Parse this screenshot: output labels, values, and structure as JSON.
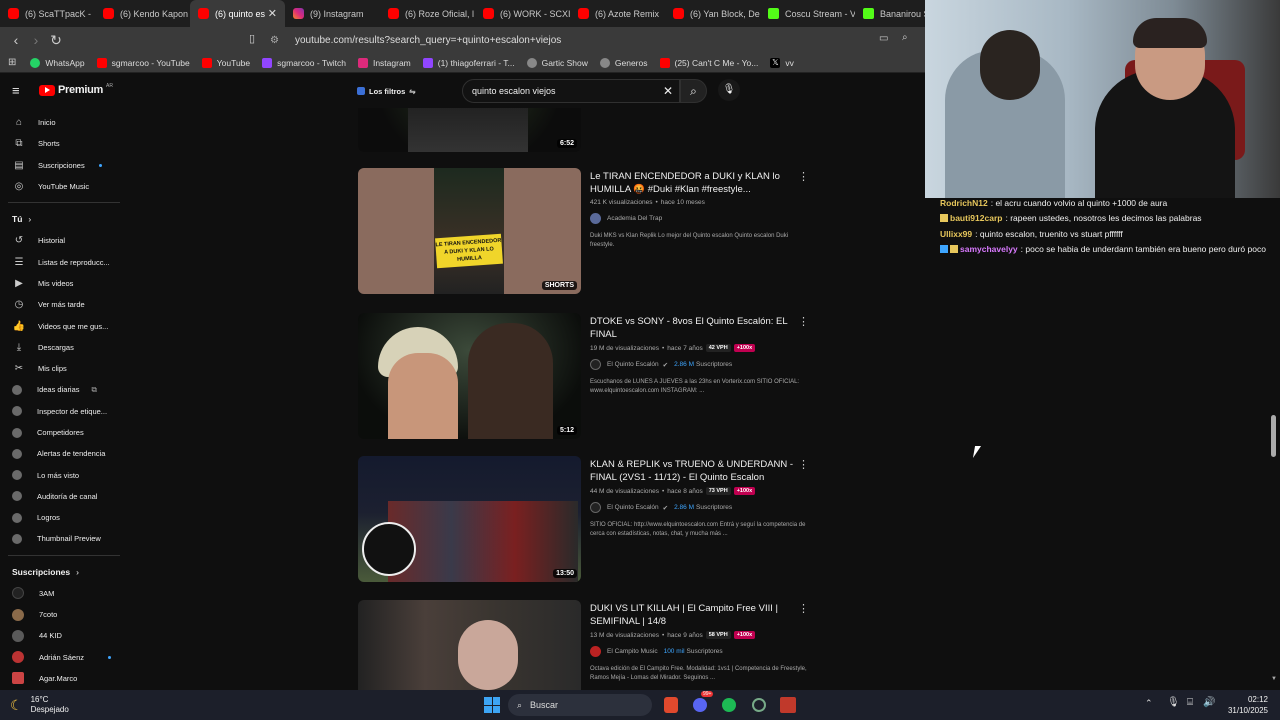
{
  "browser": {
    "tabs": [
      {
        "label": "(6) ScaTTpacK -",
        "icon": "youtube"
      },
      {
        "label": "(6) Kendo Kapon",
        "icon": "youtube"
      },
      {
        "label": "(6) quinto es",
        "icon": "youtube",
        "active": true
      },
      {
        "label": "(9) Instagram",
        "icon": "instagram"
      },
      {
        "label": "(6) Roze Oficial, l",
        "icon": "youtube"
      },
      {
        "label": "(6) WORK - SCXI",
        "icon": "youtube"
      },
      {
        "label": "(6) Azote Remix",
        "icon": "youtube"
      },
      {
        "label": "(6) Yan Block, De",
        "icon": "youtube"
      },
      {
        "label": "Coscu Stream - V",
        "icon": "kick"
      },
      {
        "label": "Bananirou St",
        "icon": "kick"
      }
    ],
    "close_glyph": "✕",
    "url": "youtube.com/results?search_query=+quinto+escalon+viejos",
    "bookmarks": [
      {
        "label": "WhatsApp",
        "color": "#25d366"
      },
      {
        "label": "sgmarcoo - YouTube",
        "color": "#ff0000"
      },
      {
        "label": "YouTube",
        "color": "#ff0000"
      },
      {
        "label": "sgmarcoo - Twitch",
        "color": "#9146ff"
      },
      {
        "label": "Instagram",
        "color": "#dd2a7b"
      },
      {
        "label": "(1) thiagoferrari - T...",
        "color": "#9146ff"
      },
      {
        "label": "Gartic Show",
        "color": "#888888"
      },
      {
        "label": "Generos",
        "color": "#888888"
      },
      {
        "label": "(25) Can't C Me - Yo...",
        "color": "#ff0000"
      },
      {
        "label": "vv",
        "color": "#000000"
      }
    ]
  },
  "youtube": {
    "logo": "Premium",
    "region": "AR",
    "filters": "Los filtros",
    "search_value": "quinto escalon viejos",
    "sidebar": {
      "main": [
        "Inicio",
        "Shorts",
        "Suscripciones",
        "YouTube Music"
      ],
      "you_header": "Tú",
      "you": [
        "Historial",
        "Listas de reproducc...",
        "Mis videos",
        "Ver más tarde",
        "Videos que me gus...",
        "Descargas",
        "Mis clips"
      ],
      "tools": [
        "Ideas diarias",
        "Inspector de etique...",
        "Competidores",
        "Alertas de tendencia",
        "Lo más visto",
        "Auditoría de canal",
        "Logros",
        "Thumbnail Preview"
      ],
      "subs_header": "Suscripciones",
      "subs": [
        "3AM",
        "7coto",
        "44 KID",
        "Adrián Sáenz",
        "Agar.Marco"
      ]
    },
    "videos": [
      {
        "title": "",
        "duration": "6:52"
      },
      {
        "title": "Le TIRAN ENCENDEDOR a DUKI y KLAN lo HUMILLA 🤬 #Duki #Klan #freestyle...",
        "meta_views": "421 K visualizaciones",
        "meta_age": "hace 10 meses",
        "channel": "Academia Del Trap",
        "subs": "",
        "desc": "Duki MKS vs Klan Replik Lo mejor del Quinto escalon Quinto escalon Duki freestyle.",
        "duration": "SHORTS",
        "thumb_caption": "LE TIRAN ENCENDEDOR A DUKI Y KLAN LO HUMILLA"
      },
      {
        "title": "DTOKE vs SONY - 8vos El Quinto Escalón: EL FINAL",
        "meta_views": "19 M de visualizaciones",
        "meta_age": "hace 7 años",
        "vph": "42 VPH",
        "ratio": "+100x",
        "channel": "El Quinto Escalón",
        "subs": "2.86 M",
        "subs_suffix": "Suscriptores",
        "desc": "Escuchanos de LUNES A JUEVES a las 23hs en Vorterix.com SITIO OFICIAL: www.elquintoescalon.com INSTAGRAM: ...",
        "duration": "5:12"
      },
      {
        "title": "KLAN & REPLIK vs TRUENO & UNDERDANN - FINAL (2VS1 - 11/12) - El Quinto Escalon",
        "meta_views": "44 M de visualizaciones",
        "meta_age": "hace 8 años",
        "vph": "73 VPH",
        "ratio": "+100x",
        "channel": "El Quinto Escalón",
        "subs": "2.86 M",
        "subs_suffix": "Suscriptores",
        "desc": "SITIO OFICIAL: http://www.elquintoescalon.com Entrá y seguí la competencia de cerca con estadísticas, notas, chat, y mucha más ...",
        "duration": "13:50"
      },
      {
        "title": "DUKI VS LIT KILLAH | El Campito Free VIII | SEMIFINAL | 14/8",
        "meta_views": "13 M de visualizaciones",
        "meta_age": "hace 9 años",
        "vph": "58 VPH",
        "ratio": "+100x",
        "channel": "El Campito Music",
        "subs": "100 mil",
        "subs_suffix": "Suscriptores",
        "desc": "Octava edición de El Campito Free. Modalidad: 1vs1 | Competencia de Freestyle, Ramos Mejía - Lomas del Mirador. Seguinos ...",
        "duration": ""
      }
    ]
  },
  "chat": [
    {
      "user": "RodrichN12",
      "text": "el acru cuando volvio al quinto +1000 de aura",
      "color": "#e7c75c"
    },
    {
      "user": "bauti912carp",
      "text": "rapeen ustedes, nosotros les decimos las palabras",
      "color": "#e7c75c"
    },
    {
      "user": "Ullixx99",
      "text": "quinto escalon, truenito vs stuart pffffff",
      "color": "#e7c75c"
    },
    {
      "user": "samychavelyy",
      "text": "poco se habia de underdann también era bueno pero duró poco",
      "color": "#d97aff"
    }
  ],
  "taskbar": {
    "weather_temp": "16°C",
    "weather_desc": "Despejado",
    "search": "Buscar",
    "time": "02:12",
    "date": "31/10/2025",
    "discord_badge": "99+"
  }
}
